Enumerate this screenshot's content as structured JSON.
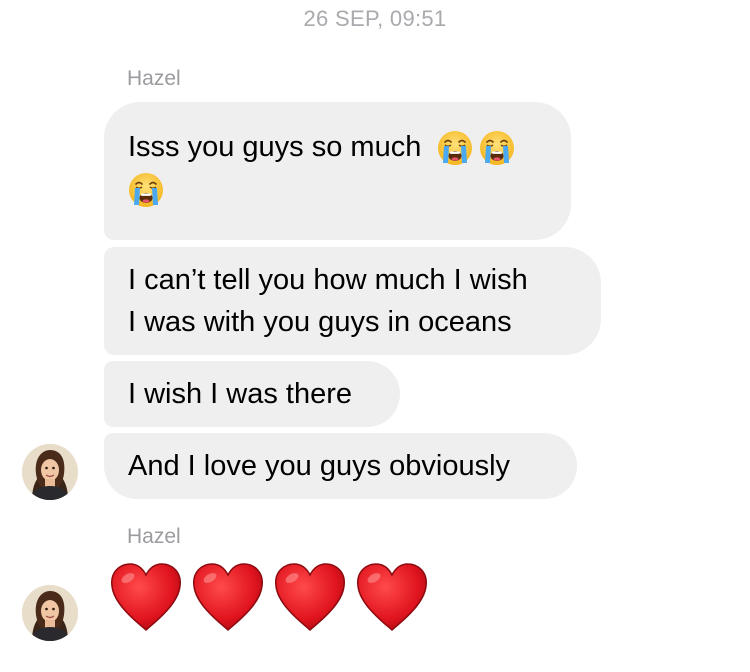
{
  "thread": {
    "timestamp": "26 SEP, 09:51"
  },
  "groups": [
    {
      "sender": "Hazel",
      "messages": [
        {
          "lines": [
            "Isss you guys so much"
          ],
          "emoji": [
            "loudly-crying-face",
            "loudly-crying-face",
            "loudly-crying-face"
          ]
        },
        {
          "lines": [
            "I can’t tell you how much I wish",
            "I was with you guys in oceans"
          ]
        },
        {
          "lines": [
            "I wish I was there"
          ]
        },
        {
          "lines": [
            "And I love you guys obviously"
          ]
        }
      ],
      "avatar": "hazel-avatar"
    },
    {
      "sender": "Hazel",
      "messages": [
        {
          "emoji": [
            "red-heart",
            "red-heart",
            "red-heart",
            "red-heart"
          ]
        }
      ],
      "avatar": "hazel-avatar"
    }
  ],
  "colors": {
    "bubble_background": "#efeff0",
    "timestamp_text": "#a9a9ae",
    "sender_text": "#9b9ba0",
    "heart_red": "#e0141e"
  }
}
